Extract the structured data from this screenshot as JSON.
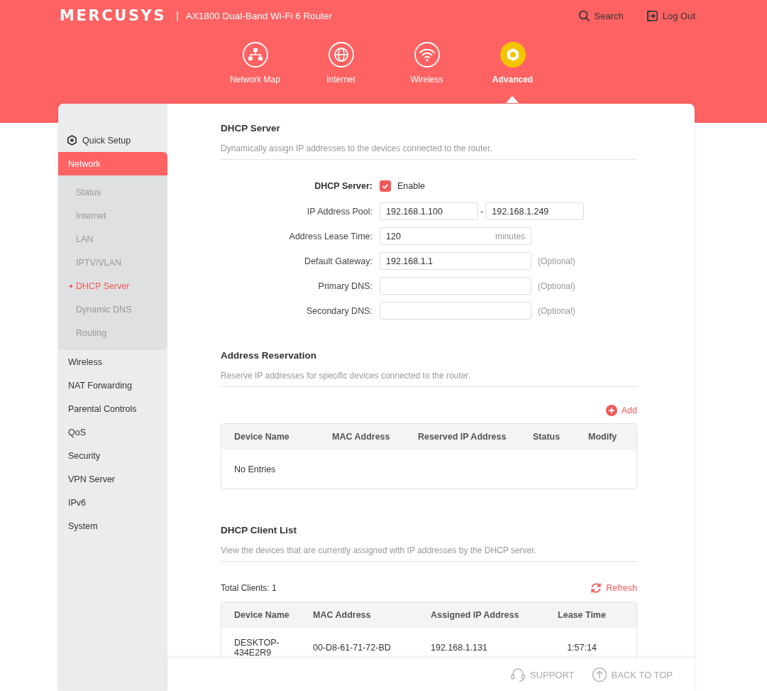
{
  "header": {
    "logo": "MERCUSYS",
    "separator": "|",
    "product": "AX1800 Dual-Band Wi-Fi 6 Router",
    "actions": [
      {
        "kind": "search",
        "label": "Search"
      },
      {
        "kind": "logout",
        "label": "Log Out"
      }
    ]
  },
  "nav": [
    {
      "kind": "map",
      "label": "Network Map",
      "selected": false
    },
    {
      "kind": "internet",
      "label": "Internet",
      "selected": false
    },
    {
      "kind": "wireless",
      "label": "Wireless",
      "selected": false
    },
    {
      "kind": "advanced",
      "label": "Advanced",
      "selected": true
    }
  ],
  "sidebar": {
    "items": [
      {
        "kind": "quick",
        "label": "Quick Setup",
        "selected": false
      },
      {
        "kind": "menu",
        "label": "Network",
        "selected": true,
        "expanded": true,
        "children": [
          {
            "label": "Status",
            "selected": false
          },
          {
            "label": "Internet",
            "selected": false
          },
          {
            "label": "LAN",
            "selected": false
          },
          {
            "label": "IPTV/VLAN",
            "selected": false
          },
          {
            "label": "DHCP Server",
            "selected": true
          },
          {
            "label": "Dynamic DNS",
            "selected": false
          },
          {
            "label": "Routing",
            "selected": false
          }
        ]
      },
      {
        "kind": "menu",
        "label": "Wireless",
        "selected": false
      },
      {
        "kind": "menu",
        "label": "NAT Forwarding",
        "selected": false
      },
      {
        "kind": "menu",
        "label": "Parental Controls",
        "selected": false
      },
      {
        "kind": "menu",
        "label": "QoS",
        "selected": false
      },
      {
        "kind": "menu",
        "label": "Security",
        "selected": false
      },
      {
        "kind": "menu",
        "label": "VPN Server",
        "selected": false
      },
      {
        "kind": "menu",
        "label": "IPv6",
        "selected": false
      },
      {
        "kind": "menu",
        "label": "System",
        "selected": false
      }
    ]
  },
  "dhcp_server": {
    "title": "DHCP Server",
    "description": "Dynamically assign IP addresses to the devices connected to the router.",
    "fields": [
      {
        "kind": "checkbox",
        "label": "DHCP Server:",
        "option": "Enable",
        "checked": true
      },
      {
        "kind": "range",
        "label": "IP Address Pool:",
        "values": [
          "192.168.1.100",
          "192.168.1.249"
        ],
        "separator": "-"
      },
      {
        "kind": "text",
        "label": "Address Lease Time:",
        "value": "120",
        "unit": "minutes"
      },
      {
        "kind": "text",
        "label": "Default Gateway:",
        "value": "192.168.1.1",
        "note": "(Optional)"
      },
      {
        "kind": "text",
        "label": "Primary DNS:",
        "note": "(Optional)"
      },
      {
        "kind": "text",
        "label": "Secondary DNS:",
        "note": "(Optional)"
      }
    ]
  },
  "address_reservation": {
    "title": "Address Reservation",
    "description": "Reserve IP addresses for specific devices connected to the router.",
    "add_button": "Add",
    "table": {
      "columns": [
        "Device Name",
        "MAC Address",
        "Reserved IP Address",
        "Status",
        "Modify"
      ],
      "empty_text": "No Entries"
    }
  },
  "dhcp_client_list": {
    "title": "DHCP Client List",
    "description": "View the devices that are currently assigned with IP addresses by the DHCP server.",
    "total": "Total Clients: 1",
    "refresh_button": "Refresh",
    "table": {
      "columns": [
        "Device Name",
        "MAC Address",
        "Assigned IP Address",
        "Lease Time"
      ],
      "rows": [
        [
          "DESKTOP-434E2R9",
          "00-D8-61-71-72-BD",
          "192.168.1.131",
          "1:57:14"
        ]
      ]
    }
  },
  "footer": {
    "links": [
      {
        "kind": "support",
        "label": "SUPPORT"
      },
      {
        "kind": "top",
        "label": "BACK TO TOP"
      }
    ]
  }
}
